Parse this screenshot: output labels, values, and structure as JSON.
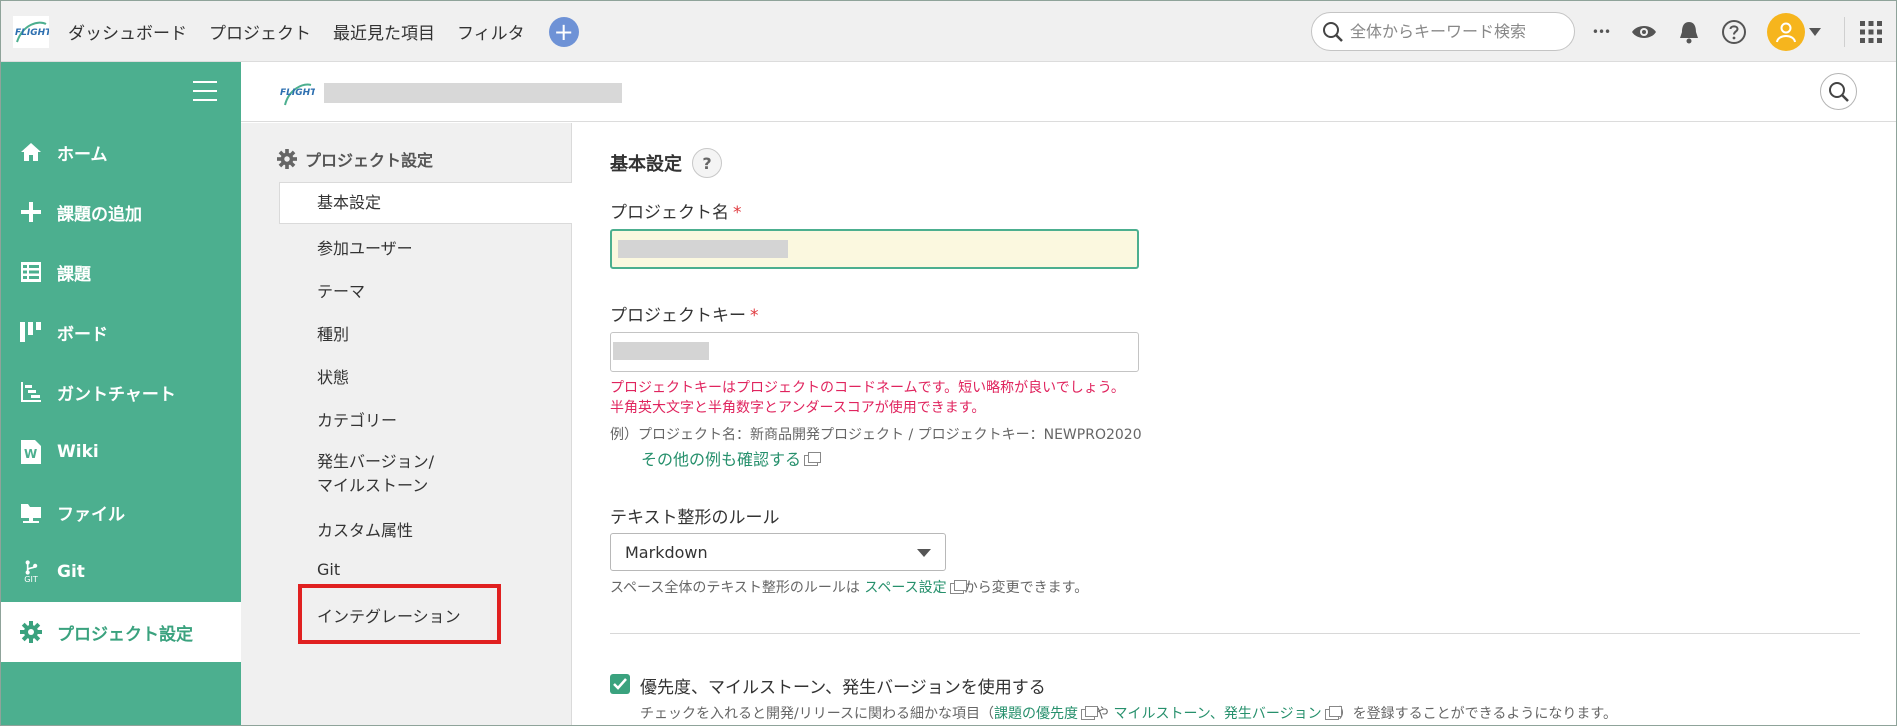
{
  "topbar": {
    "logo_text": "FLIGHT",
    "nav": [
      "ダッシュボード",
      "プロジェクト",
      "最近見た項目",
      "フィルタ"
    ],
    "add_label": "+",
    "search_placeholder": "全体からキーワード検索",
    "more_label": "•••"
  },
  "sidebar": {
    "items": [
      {
        "label": "ホーム",
        "icon": "home-icon"
      },
      {
        "label": "課題の追加",
        "icon": "plus-icon"
      },
      {
        "label": "課題",
        "icon": "list-icon"
      },
      {
        "label": "ボード",
        "icon": "board-icon"
      },
      {
        "label": "ガントチャート",
        "icon": "gantt-icon"
      },
      {
        "label": "Wiki",
        "icon": "wiki-icon"
      },
      {
        "label": "ファイル",
        "icon": "file-icon"
      },
      {
        "label": "Git",
        "icon": "git-icon"
      },
      {
        "label": "プロジェクト設定",
        "icon": "gear-icon"
      }
    ],
    "git_sublabel": "GIT"
  },
  "submenu": {
    "title": "プロジェクト設定",
    "items": [
      "基本設定",
      "参加ユーザー",
      "テーマ",
      "種別",
      "状態",
      "カテゴリー",
      "発生バージョン/",
      "カスタム属性",
      "Git",
      "インテグレーション"
    ],
    "item_version_line2": "マイルストーン"
  },
  "main": {
    "section_title": "基本設定",
    "help_label": "?",
    "project_name_label": "プロジェクト名",
    "project_key_label": "プロジェクトキー",
    "required_mark": "*",
    "key_error_1": "プロジェクトキーはプロジェクトのコードネームです。短い略称が良いでしょう。",
    "key_error_2": "半角英大文字と半角数字とアンダースコアが使用できます。",
    "key_example": "例）プロジェクト名：新商品開発プロジェクト / プロジェクトキー：NEWPRO2020",
    "key_example_link": "その他の例も確認する",
    "text_rule_label": "テキスト整形のルール",
    "text_rule_value": "Markdown",
    "text_rule_hint_pre": "スペース全体のテキスト整形のルールは",
    "text_rule_hint_link": "スペース設定",
    "text_rule_hint_post": "から変更できます。",
    "checkbox_label": "優先度、マイルストーン、発生バージョンを使用する",
    "checkbox_hint_pre": "チェックを入れると開発/リリースに関わる細かな項目（",
    "checkbox_hint_link1": "課題の優先度",
    "checkbox_hint_mid": "や",
    "checkbox_hint_link2": "マイルストーン、発生バージョン",
    "checkbox_hint_post": "）を登録することができるようになります。"
  },
  "colors": {
    "accent": "#4caf8f",
    "highlight": "#e02020",
    "error": "#e0245e",
    "link": "#26906c"
  }
}
